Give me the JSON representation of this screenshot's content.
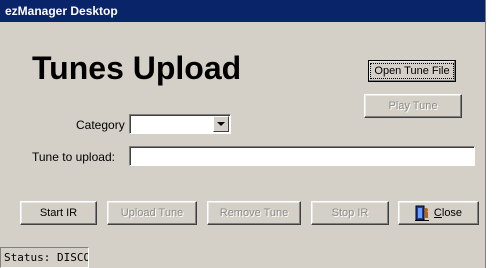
{
  "window": {
    "title": "ezManager Desktop"
  },
  "header": {
    "title": "Tunes Upload"
  },
  "buttons": {
    "open_tune_file": "Open Tune File",
    "play_tune": "Play Tune",
    "start_ir": "Start IR",
    "upload_tune": "Upload Tune",
    "remove_tune": "Remove Tune",
    "stop_ir": "Stop IR",
    "close": "Close"
  },
  "form": {
    "category_label": "Category",
    "category_value": "",
    "tune_label": "Tune to upload:",
    "tune_value": ""
  },
  "status": {
    "text": "Status: DISCO"
  },
  "icons": {
    "close": "door-exit-icon",
    "dropdown": "chevron-down-icon"
  },
  "colors": {
    "titlebar": "#0a246a",
    "face": "#d4d0c8",
    "disabled_text": "#8c8a86"
  }
}
